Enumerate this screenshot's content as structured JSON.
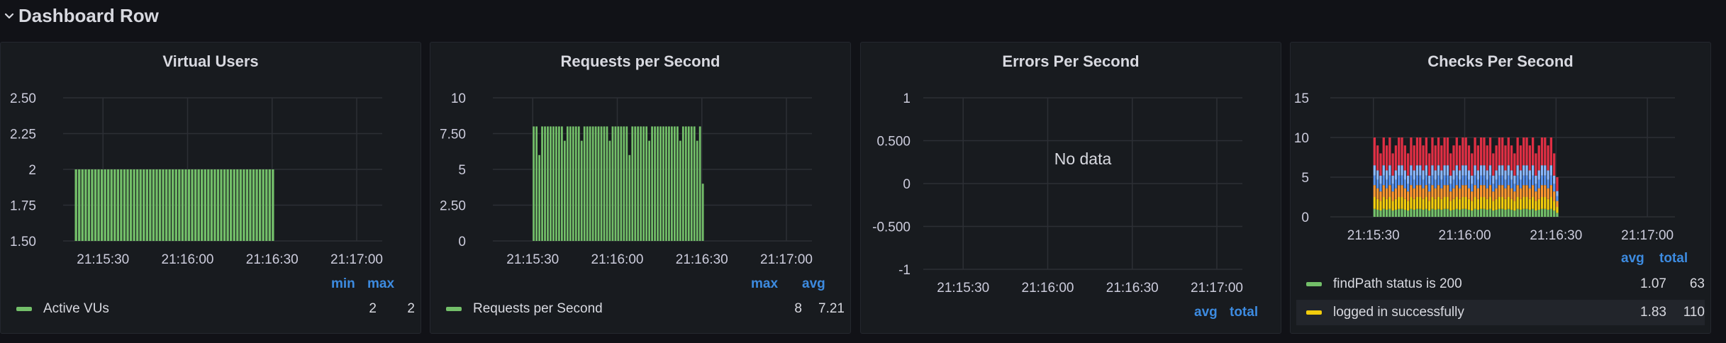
{
  "row": {
    "title": "Dashboard Row",
    "icon": "chevron-down-icon"
  },
  "panels": [
    {
      "title": "Virtual Users",
      "legend": {
        "headers": [
          "min",
          "max"
        ],
        "rows": [
          {
            "name": "Active VUs",
            "color": "#73bf69",
            "values": [
              "2",
              "2"
            ]
          }
        ]
      }
    },
    {
      "title": "Requests per Second",
      "legend": {
        "headers": [
          "max",
          "avg"
        ],
        "rows": [
          {
            "name": "Requests per Second",
            "color": "#73bf69",
            "values": [
              "8",
              "7.21"
            ]
          }
        ]
      }
    },
    {
      "title": "Errors Per Second",
      "no_data": "No data",
      "legend": {
        "headers": [
          "avg",
          "total"
        ],
        "rows": []
      }
    },
    {
      "title": "Checks Per Second",
      "legend": {
        "headers": [
          "avg",
          "total"
        ],
        "rows": [
          {
            "name": "findPath status is 200",
            "color": "#73bf69",
            "values": [
              "1.07",
              "63"
            ]
          },
          {
            "name": "logged in successfully",
            "color": "#f2cc0c",
            "values": [
              "1.83",
              "110"
            ]
          }
        ]
      }
    }
  ],
  "chart_data": [
    {
      "type": "bar",
      "title": "Virtual Users",
      "x_ticks": [
        "21:15:30",
        "21:16:00",
        "21:16:30",
        "21:17:00"
      ],
      "y_ticks": [
        "1.50",
        "1.75",
        "2",
        "2.25",
        "2.50"
      ],
      "ylim": [
        1.5,
        2.5
      ],
      "series": [
        {
          "name": "Active VUs",
          "color": "#73bf69",
          "x_range": [
            "21:15:20",
            "21:16:31"
          ],
          "value": 2
        }
      ]
    },
    {
      "type": "bar",
      "title": "Requests per Second",
      "x_ticks": [
        "21:15:30",
        "21:16:00",
        "21:16:30",
        "21:17:00"
      ],
      "y_ticks": [
        "0",
        "2.50",
        "5",
        "7.50",
        "10"
      ],
      "ylim": [
        0,
        10
      ],
      "series": [
        {
          "name": "Requests per Second",
          "color": "#73bf69",
          "x_range": [
            "21:15:30",
            "21:16:31"
          ],
          "values": [
            8,
            8,
            6,
            8,
            8,
            8,
            8,
            8,
            8,
            8,
            8,
            7,
            8,
            8,
            8,
            8,
            8,
            7,
            8,
            8,
            8,
            8,
            8,
            8,
            8,
            8,
            8,
            7,
            8,
            8,
            8,
            8,
            8,
            8,
            6,
            8,
            8,
            8,
            8,
            8,
            8,
            7,
            8,
            8,
            8,
            8,
            8,
            8,
            8,
            8,
            8,
            8,
            7,
            8,
            8,
            8,
            8,
            8,
            7,
            8,
            4
          ]
        }
      ]
    },
    {
      "type": "bar",
      "title": "Errors Per Second",
      "x_ticks": [
        "21:15:30",
        "21:16:00",
        "21:16:30",
        "21:17:00"
      ],
      "y_ticks": [
        "-1",
        "-0.500",
        "0",
        "0.500",
        "1"
      ],
      "ylim": [
        -1,
        1
      ],
      "series": []
    },
    {
      "type": "bar",
      "stacked": true,
      "title": "Checks Per Second",
      "x_ticks": [
        "21:15:30",
        "21:16:00",
        "21:16:30",
        "21:17:00"
      ],
      "y_ticks": [
        "0",
        "5",
        "10",
        "15"
      ],
      "ylim": [
        0,
        15
      ],
      "x_range": [
        "21:15:30",
        "21:16:31"
      ],
      "series": [
        {
          "name": "findPath status is 200",
          "color": "#73bf69"
        },
        {
          "name": "logged in successfully",
          "color": "#f2cc0c"
        },
        {
          "color": "#ff9830"
        },
        {
          "color": "#5794f2"
        },
        {
          "color": "#8ab8ff"
        },
        {
          "color": "#e02f44"
        }
      ],
      "totals": [
        10,
        9,
        8,
        10,
        9,
        10,
        8,
        9,
        10,
        10,
        9,
        8,
        10,
        9,
        10,
        10,
        9,
        10,
        8,
        10,
        9,
        10,
        9,
        10,
        10,
        8,
        9,
        10,
        9,
        10,
        10,
        9,
        8,
        10,
        9,
        10,
        10,
        9,
        10,
        8,
        9,
        10,
        10,
        9,
        10,
        9,
        8,
        10,
        9,
        10,
        10,
        9,
        10,
        8,
        9,
        10,
        10,
        9,
        10,
        8,
        5
      ]
    }
  ]
}
